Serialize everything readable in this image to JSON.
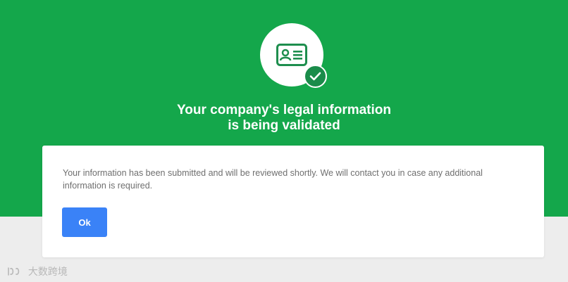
{
  "colors": {
    "hero_background": "#14a74b",
    "page_background": "#ededed",
    "check_badge": "#1a8c4a",
    "icon_green": "#1e8e4e",
    "button_blue": "#3a82f7",
    "body_text": "#6f6f6f"
  },
  "icons": {
    "hero_icon": "id-card-icon",
    "status_icon": "checkmark-icon"
  },
  "header": {
    "title_line1": "Your company's legal information",
    "title_line2": "is being validated"
  },
  "dialog": {
    "message": "Your information has been submitted and will be reviewed shortly. We will contact you in case any additional information is required.",
    "ok_label": "Ok"
  },
  "watermark": {
    "text": "大数跨境"
  }
}
